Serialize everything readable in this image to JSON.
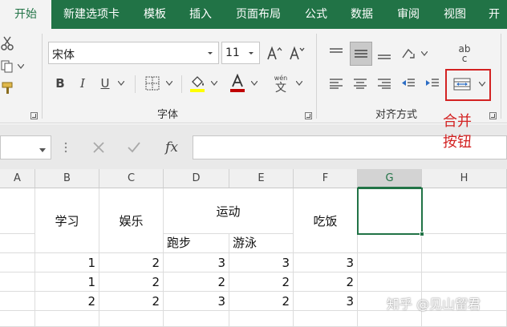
{
  "tabs": [
    "开始",
    "新建选项卡",
    "模板",
    "插入",
    "页面布局",
    "公式",
    "数据",
    "审阅",
    "视图",
    "开"
  ],
  "font": {
    "name": "宋体",
    "size": "11",
    "bold": "B",
    "italic": "I",
    "underline": "U",
    "phonetic_top": "wén",
    "phonetic_bottom": "文",
    "group_label": "字体"
  },
  "alignment": {
    "wrap_top": "ab",
    "wrap_bottom": "c",
    "group_label": "对齐方式"
  },
  "annotation": [
    "合并",
    "按钮"
  ],
  "formula_bar": {
    "fx": "fx",
    "value": ""
  },
  "columns": [
    "A",
    "B",
    "C",
    "D",
    "E",
    "F",
    "G",
    "H"
  ],
  "selected_column": "G",
  "headers": {
    "study": "学习",
    "entertainment": "娱乐",
    "sports": "运动",
    "running": "跑步",
    "swimming": "游泳",
    "eating": "吃饭"
  },
  "rows": [
    [
      "1",
      "2",
      "3",
      "3",
      "3"
    ],
    [
      "1",
      "2",
      "2",
      "2",
      "2"
    ],
    [
      "2",
      "2",
      "3",
      "2",
      "3"
    ]
  ],
  "watermark": "知乎 @见山留君",
  "colors": {
    "accent": "#217346",
    "annotation": "#d32222",
    "highlight_yellow": "#ffff00"
  }
}
